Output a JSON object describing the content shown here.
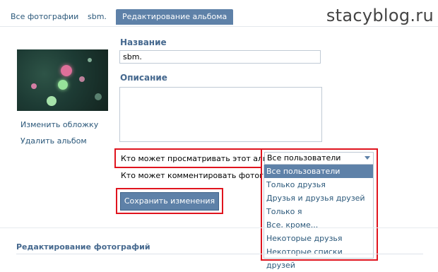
{
  "tabs": [
    {
      "label": "Все фотографии"
    },
    {
      "label": "sbm."
    },
    {
      "label": "Редактирование альбома"
    }
  ],
  "watermark": "stacyblog.ru",
  "sidebar": {
    "change_cover": "Изменить обложку",
    "delete_album": "Удалить альбом"
  },
  "form": {
    "name_label": "Название",
    "name_value": "sbm.",
    "description_label": "Описание",
    "description_value": "",
    "view_privacy_label": "Кто может просматривать этот альбом?",
    "comment_privacy_label": "Кто может комментировать фотографии?",
    "view_privacy_selected": "Все пользователи",
    "save_button": "Сохранить изменения"
  },
  "dropdown": {
    "options": [
      "Все пользователи",
      "Только друзья",
      "Друзья и друзья друзей",
      "Только я",
      "Все, кроме...",
      "Некоторые друзья",
      "Некоторые списки друзей"
    ],
    "selected_index": 0
  },
  "photos_section": {
    "title": "Редактирование фотографий"
  },
  "colors": {
    "accent": "#5e81a8",
    "link": "#2b587a",
    "highlight_border": "#e0141e"
  }
}
